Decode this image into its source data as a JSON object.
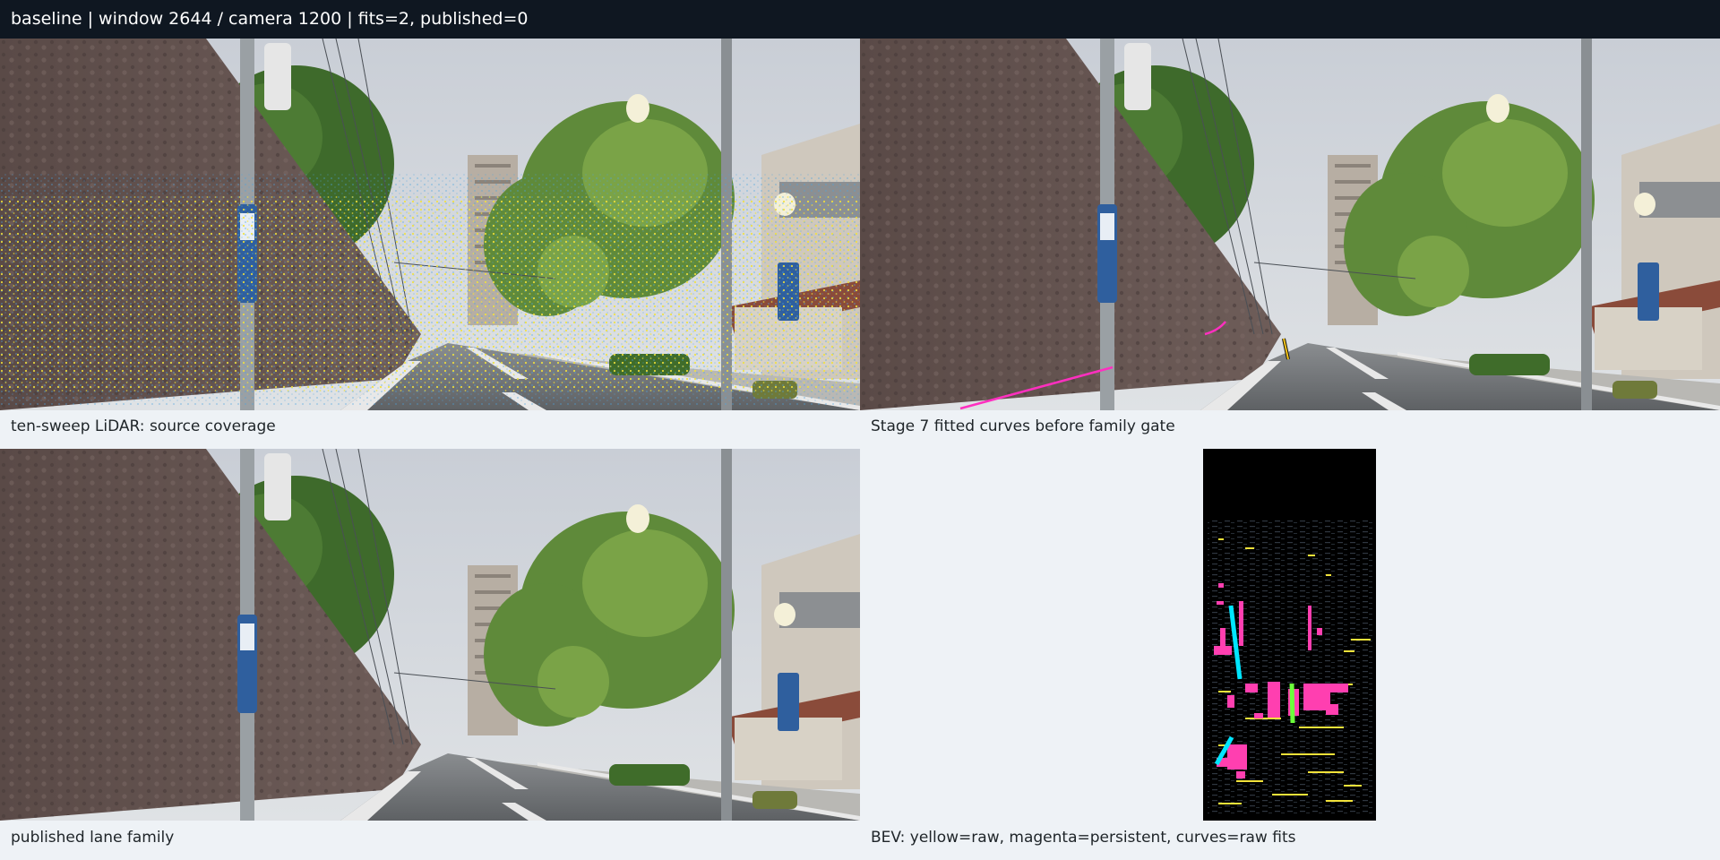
{
  "header": {
    "status_text": "baseline | window 2644 / camera 1200 | fits=2, published=0"
  },
  "panels": [
    {
      "caption": "ten-sweep LiDAR: source coverage"
    },
    {
      "caption": "Stage 7 fitted curves before family gate"
    },
    {
      "caption": "published lane family"
    },
    {
      "caption": "BEV: yellow=raw, magenta=persistent, curves=raw fits"
    }
  ],
  "legend_colors": {
    "raw": "#f2e23a",
    "persistent": "#ff3fb0",
    "fit_a": "#00e5ff",
    "fit_b": "#6cff3a"
  }
}
